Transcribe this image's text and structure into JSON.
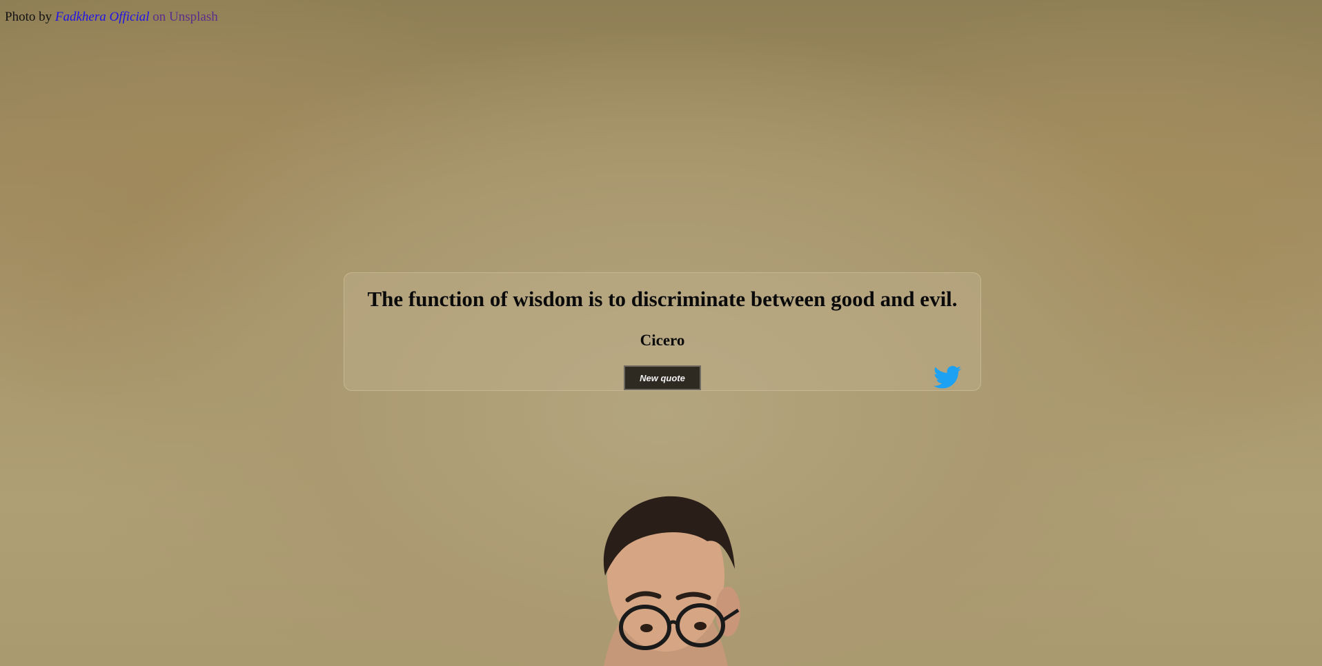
{
  "credit": {
    "prefix": "Photo by ",
    "author": "Fadkhera Official",
    "middle": " on ",
    "site": "Unsplash"
  },
  "quote": {
    "text": "The function of wisdom is to discriminate between good and evil.",
    "author": "Cicero",
    "new_quote_label": "New quote"
  },
  "icons": {
    "tweet": "twitter-bird-icon"
  },
  "colors": {
    "twitter_blue": "#1da1f2",
    "button_bg": "#2e2a22",
    "author_link": "#1f12e8",
    "site_link": "#5a2d8c"
  }
}
